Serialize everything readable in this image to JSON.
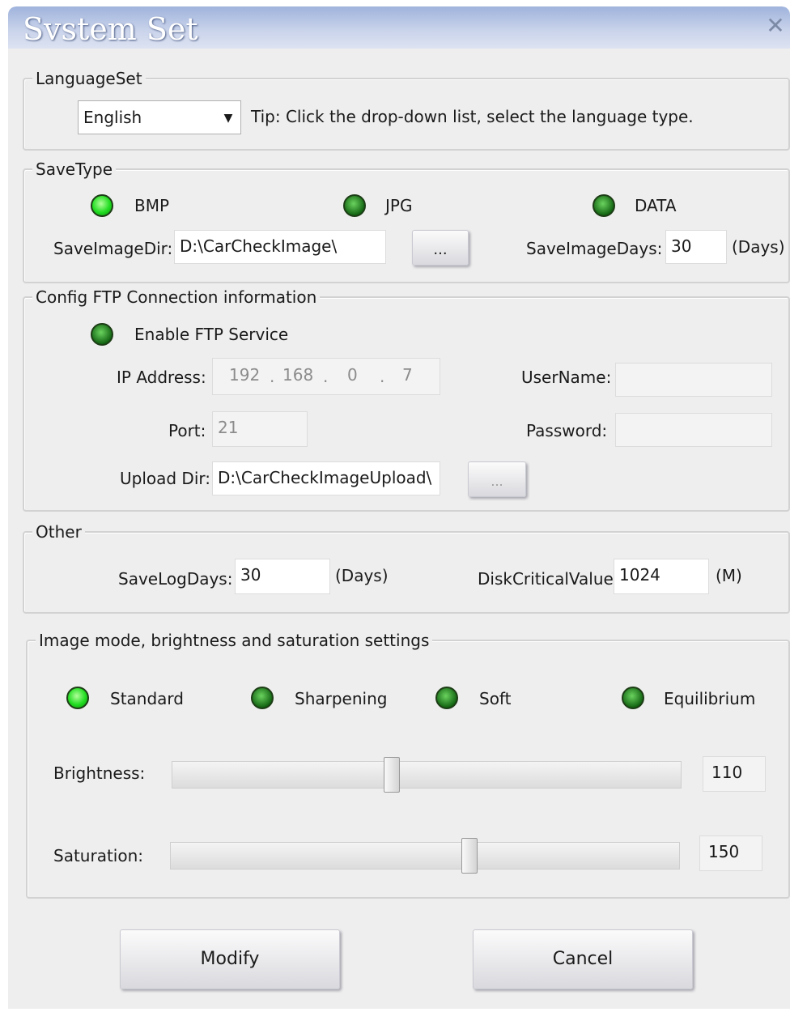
{
  "window": {
    "title": "Svstem Set",
    "close_icon": "close-icon"
  },
  "language": {
    "group_label": "LanguageSet",
    "selected": "English",
    "dropdown_icon": "chevron-down-icon",
    "tip": "Tip: Click the drop-down list, select the language type."
  },
  "save_type": {
    "group_label": "SaveType",
    "options": [
      {
        "label": "BMP",
        "selected": true
      },
      {
        "label": "JPG",
        "selected": false
      },
      {
        "label": "DATA",
        "selected": false
      }
    ],
    "dir_label": "SaveImageDir:",
    "dir_value": "D:\\CarCheckImage\\",
    "browse_label": "...",
    "days_label": "SaveImageDays:",
    "days_value": "30",
    "days_unit": "(Days)"
  },
  "ftp": {
    "group_label": "Config FTP Connection information",
    "enable_label": "Enable FTP Service",
    "enabled": false,
    "ip_label": "IP Address:",
    "ip": [
      "192",
      "168",
      "0",
      "7"
    ],
    "ip_sep": ".",
    "port_label": "Port:",
    "port_value": "21",
    "upload_label": "Upload Dir:",
    "upload_value": "D:\\CarCheckImageUpload\\",
    "browse_label": "...",
    "username_label": "UserName:",
    "username_value": "",
    "password_label": "Password:",
    "password_value": ""
  },
  "other": {
    "group_label": "Other",
    "log_label": "SaveLogDays:",
    "log_value": "30",
    "log_unit": "(Days)",
    "disk_label": "DiskCriticalValue:",
    "disk_value": "1024",
    "disk_unit": "(M)"
  },
  "image": {
    "group_label": "Image mode, brightness and saturation settings",
    "modes": [
      {
        "label": "Standard",
        "selected": true
      },
      {
        "label": "Sharpening",
        "selected": false
      },
      {
        "label": "Soft",
        "selected": false
      },
      {
        "label": "Equilibrium",
        "selected": false
      }
    ],
    "brightness_label": "Brightness:",
    "brightness_value": "110",
    "brightness_fraction": 0.43,
    "saturation_label": "Saturation:",
    "saturation_value": "150",
    "saturation_fraction": 0.59
  },
  "buttons": {
    "modify": "Modify",
    "cancel": "Cancel"
  },
  "colors": {
    "led_on": "#22dd22",
    "led_off": "#0e5e0e",
    "titlebar": "#9fb3dc"
  }
}
